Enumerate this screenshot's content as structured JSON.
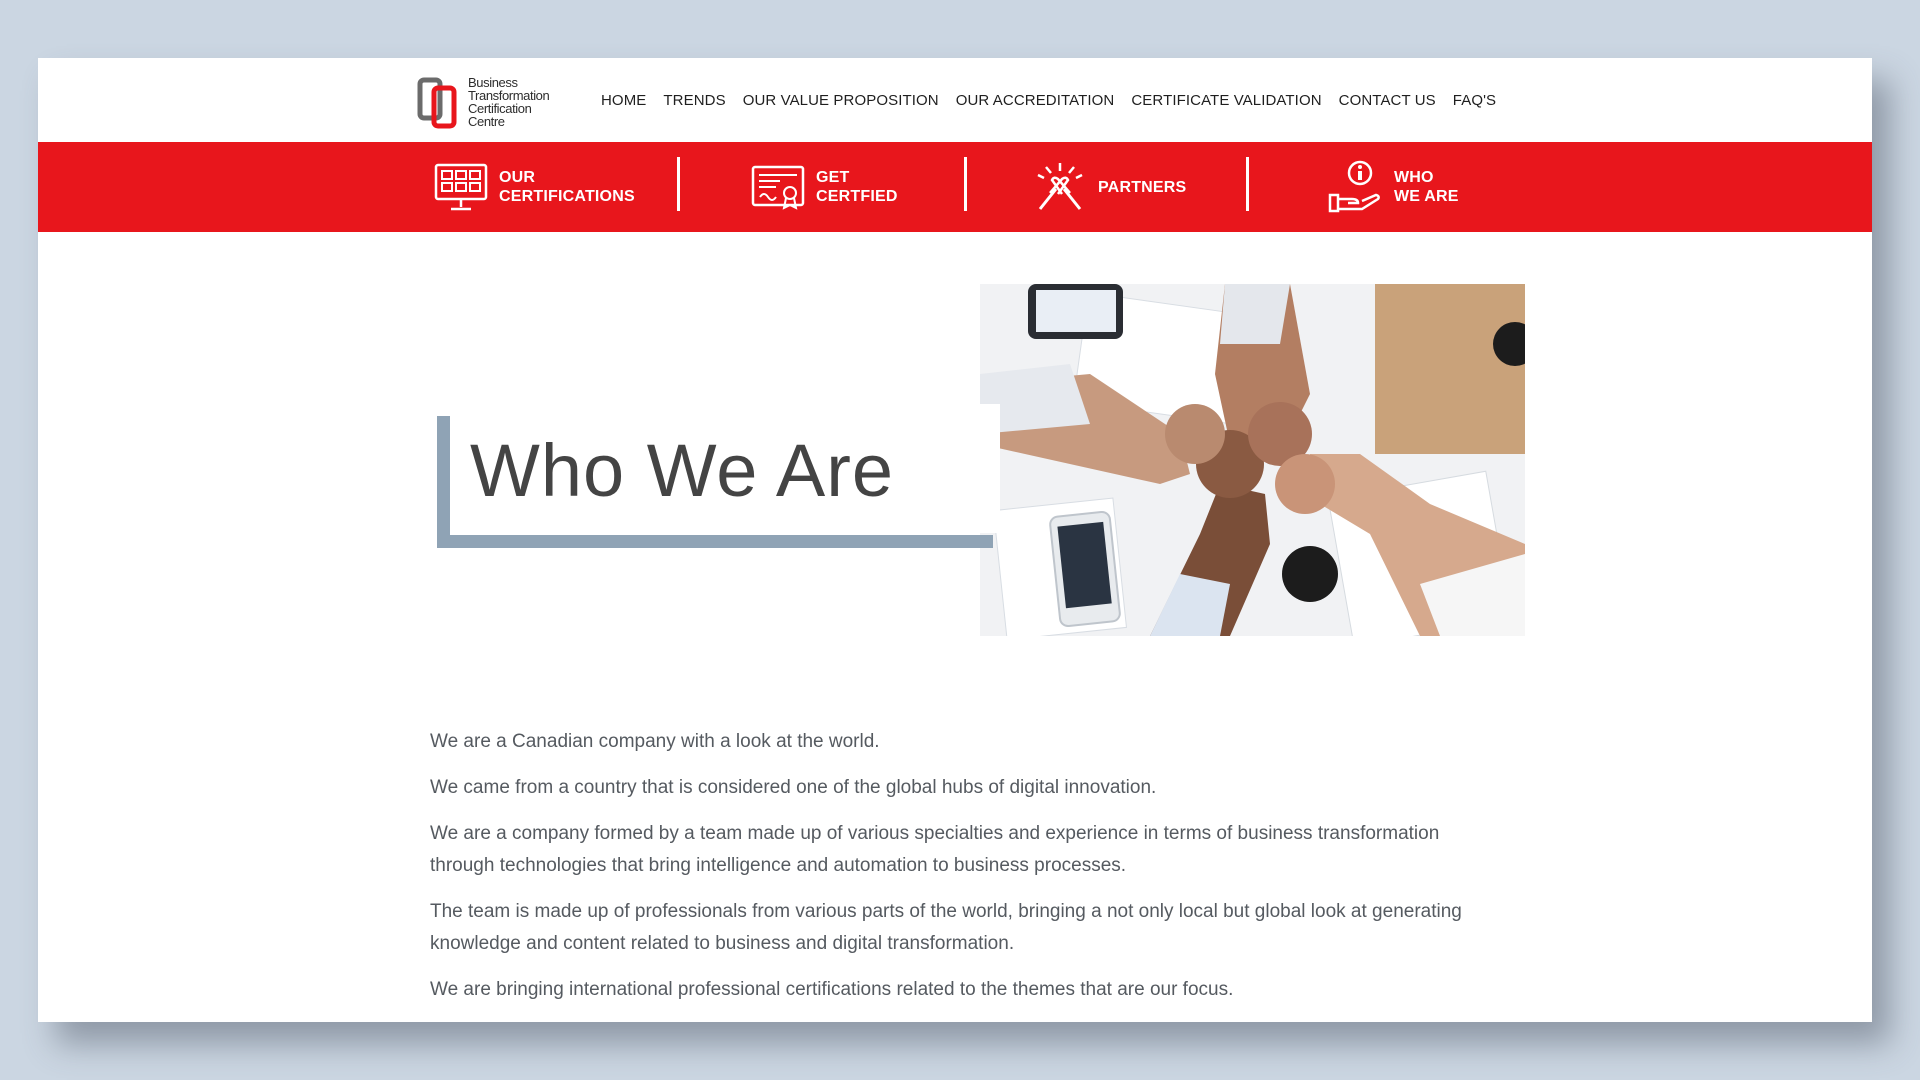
{
  "logo": {
    "lines": [
      "Business",
      "Transformation",
      "Certification",
      "Centre"
    ]
  },
  "nav": {
    "items": [
      "HOME",
      "TRENDS",
      "OUR VALUE PROPOSITION",
      "OUR ACCREDITATION",
      "CERTIFICATE VALIDATION",
      "CONTACT US",
      "FAQ'S"
    ]
  },
  "redband": {
    "items": [
      {
        "line1": "OUR",
        "line2": "CERTIFICATIONS",
        "icon": "monitor-certifications-icon"
      },
      {
        "line1": "GET",
        "line2": "CERTFIED",
        "icon": "certificate-icon"
      },
      {
        "line1": "PARTNERS",
        "line2": "",
        "icon": "handshake-icon"
      },
      {
        "line1": "WHO",
        "line2": "WE ARE",
        "icon": "info-hand-icon"
      }
    ]
  },
  "hero": {
    "title": "Who We Are",
    "image": "team-fist-bump-photo"
  },
  "body": {
    "paragraphs": [
      "We are a Canadian company with a look at the world.",
      "We came from a country that is considered one of the global hubs of digital innovation.",
      "We are a company formed by a team made up of various specialties and experience in terms of business transformation through technologies that bring intelligence and automation to business processes.",
      "The team is made up of professionals from various parts of the world, bringing a not only local but global look at generating knowledge and content related to business and digital transformation.",
      "We are bringing international professional certifications related to the themes that are our focus."
    ]
  },
  "colors": {
    "brand_red": "#e8161c",
    "accent_slate": "#8fa3b5",
    "background": "#cbd6e2"
  }
}
